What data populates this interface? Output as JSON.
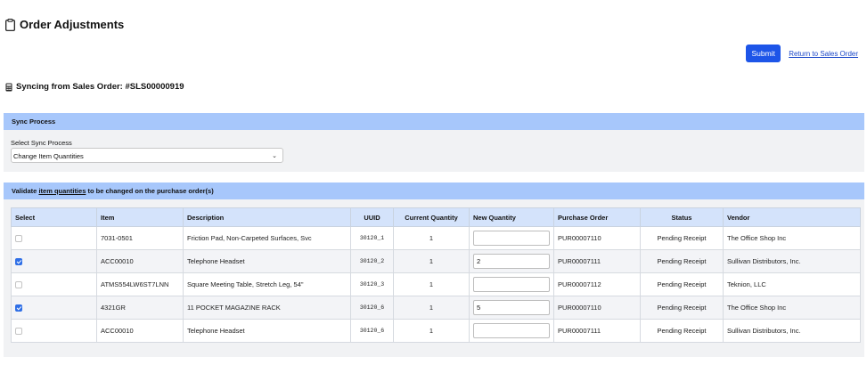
{
  "page": {
    "title": "Order Adjustments",
    "submit_label": "Submit",
    "return_label": "Return to Sales Order",
    "sync_text": "Syncing from Sales Order: #SLS00000919"
  },
  "sync_process": {
    "header": "Sync Process",
    "select_label": "Select Sync Process",
    "selected": "Change Item Quantities"
  },
  "validate": {
    "header_prefix": "Validate ",
    "header_link": "item quantities",
    "header_suffix": " to be changed on the purchase order(s)"
  },
  "table": {
    "columns": [
      "Select",
      "Item",
      "Description",
      "UUID",
      "Current Quantity",
      "New Quantity",
      "Purchase Order",
      "Status",
      "Vendor"
    ],
    "rows": [
      {
        "checked": false,
        "item": "7031-0501",
        "description": "Friction Pad, Non-Carpeted Surfaces, Svc",
        "uuid": "30120_1",
        "current": "1",
        "new": "",
        "po": "PUR00007110",
        "status": "Pending Receipt",
        "vendor": "The Office Shop Inc"
      },
      {
        "checked": true,
        "item": "ACC00010",
        "description": "Telephone Headset",
        "uuid": "30120_2",
        "current": "1",
        "new": "2",
        "po": "PUR00007111",
        "status": "Pending Receipt",
        "vendor": "Sullivan Distributors, Inc."
      },
      {
        "checked": false,
        "item": "ATMS554LW6ST7LNN",
        "description": "Square Meeting Table, Stretch Leg, 54\"",
        "uuid": "30120_3",
        "current": "1",
        "new": "",
        "po": "PUR00007112",
        "status": "Pending Receipt",
        "vendor": "Teknion, LLC"
      },
      {
        "checked": true,
        "item": "4321GR",
        "description": "11 POCKET MAGAZINE RACK",
        "uuid": "30120_6",
        "current": "1",
        "new": "5",
        "po": "PUR00007110",
        "status": "Pending Receipt",
        "vendor": "The Office Shop Inc"
      },
      {
        "checked": false,
        "item": "ACC00010",
        "description": "Telephone Headset",
        "uuid": "30120_6",
        "current": "1",
        "new": "",
        "po": "PUR00007111",
        "status": "Pending Receipt",
        "vendor": "Sullivan Distributors, Inc."
      }
    ]
  }
}
